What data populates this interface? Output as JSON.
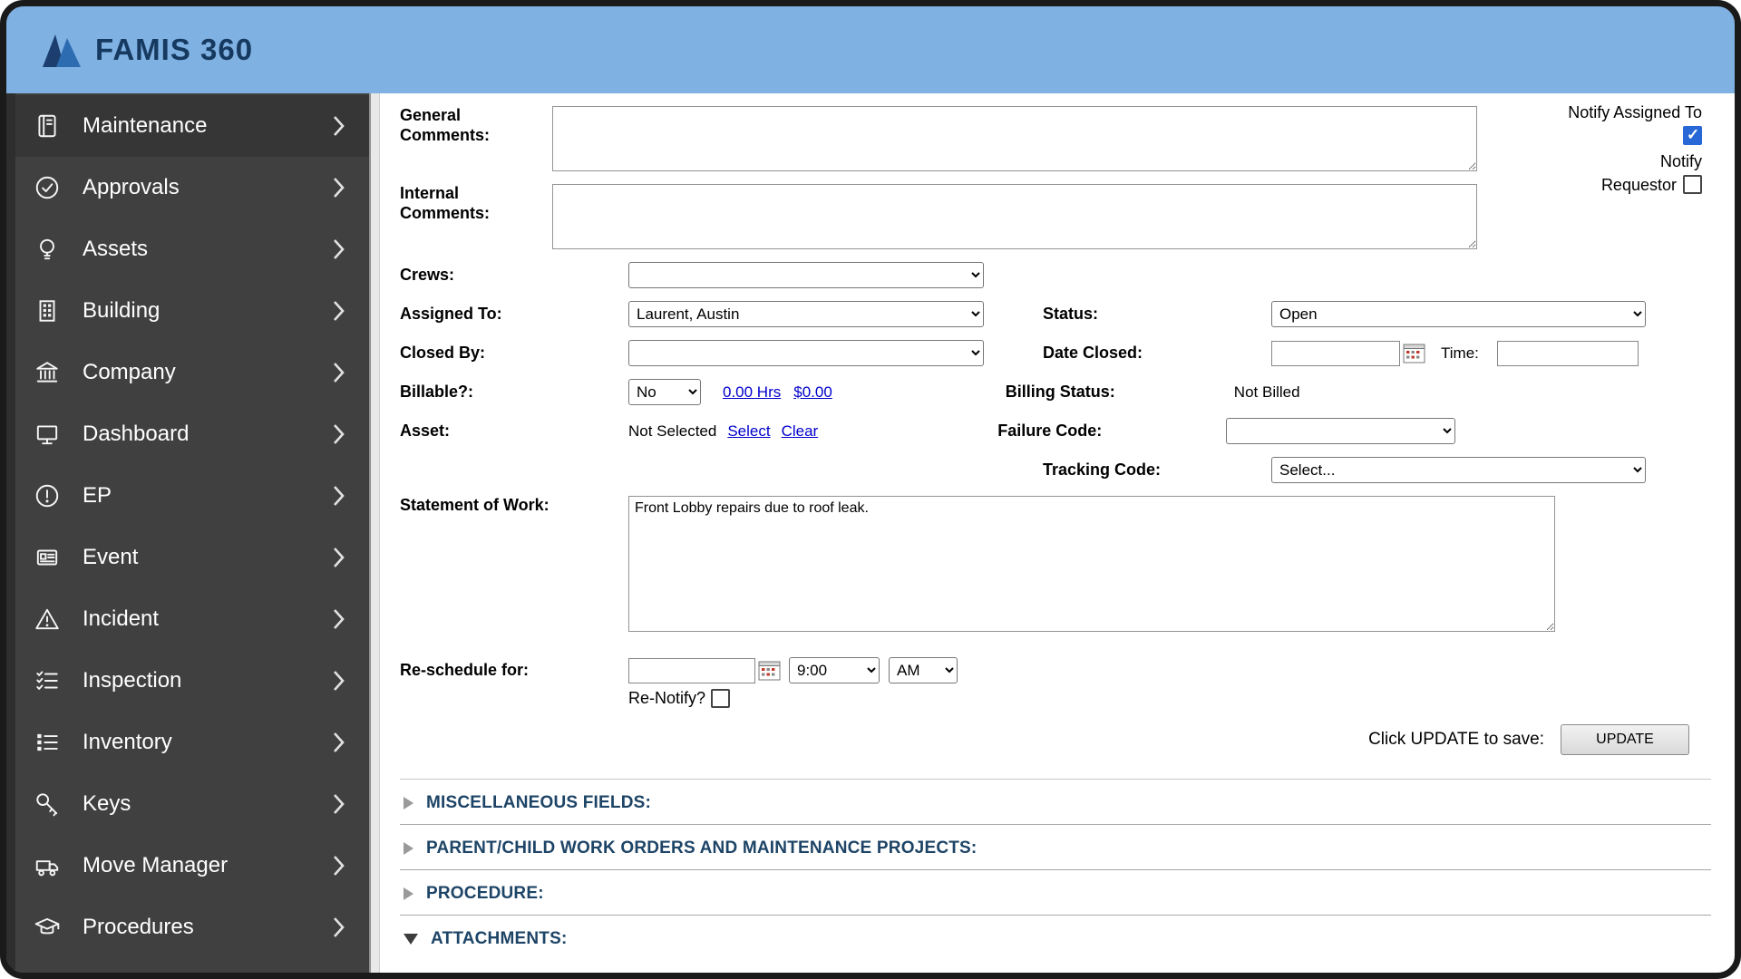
{
  "app": {
    "brand": "FAMIS 360"
  },
  "theme": {
    "header_blue": "#7fb1e3",
    "sidebar_gray": "#404040",
    "section_title_navy": "#1d4466",
    "link_blue": "#0000cc",
    "checkbox_blue": "#2767d6"
  },
  "sidebar": {
    "items": [
      {
        "label": "Maintenance",
        "icon": "book-icon"
      },
      {
        "label": "Approvals",
        "icon": "check-circle-icon"
      },
      {
        "label": "Assets",
        "icon": "lightbulb-icon"
      },
      {
        "label": "Building",
        "icon": "building-icon"
      },
      {
        "label": "Company",
        "icon": "bank-icon"
      },
      {
        "label": "Dashboard",
        "icon": "monitor-icon"
      },
      {
        "label": "EP",
        "icon": "exclamation-circle-icon"
      },
      {
        "label": "Event",
        "icon": "card-icon"
      },
      {
        "label": "Incident",
        "icon": "warning-triangle-icon"
      },
      {
        "label": "Inspection",
        "icon": "checklist-icon"
      },
      {
        "label": "Inventory",
        "icon": "list-icon"
      },
      {
        "label": "Keys",
        "icon": "key-icon"
      },
      {
        "label": "Move Manager",
        "icon": "truck-icon"
      },
      {
        "label": "Procedures",
        "icon": "graduation-cap-icon"
      }
    ]
  },
  "form": {
    "general_comments": {
      "label": "General Comments:",
      "value": ""
    },
    "internal_comments": {
      "label": "Internal Comments:",
      "value": ""
    },
    "notify": {
      "assigned_label": "Notify Assigned To",
      "assigned_checked": true,
      "requestor_label": "Notify Requestor",
      "requestor_checked": false
    },
    "crews": {
      "label": "Crews:",
      "value": ""
    },
    "assigned_to": {
      "label": "Assigned To:",
      "value": "Laurent, Austin"
    },
    "status": {
      "label": "Status:",
      "value": "Open"
    },
    "closed_by": {
      "label": "Closed By:",
      "value": ""
    },
    "date_closed": {
      "label": "Date Closed:",
      "value": "",
      "time_label": "Time:",
      "time_value": ""
    },
    "billable": {
      "label": "Billable?:",
      "value": "No",
      "hours_link": "0.00 Hrs",
      "amount_link": "$0.00"
    },
    "billing_status": {
      "label": "Billing Status:",
      "value": "Not Billed"
    },
    "asset": {
      "label": "Asset:",
      "value": "Not Selected",
      "select_link": "Select",
      "clear_link": "Clear"
    },
    "failure_code": {
      "label": "Failure Code:",
      "value": ""
    },
    "tracking_code": {
      "label": "Tracking Code:",
      "value": "Select..."
    },
    "statement_of_work": {
      "label": "Statement of Work:",
      "value": "Front Lobby repairs due to roof leak."
    },
    "reschedule": {
      "label": "Re-schedule for:",
      "date_value": "",
      "hour_value": "9:00",
      "ampm_value": "AM",
      "renotify_label": "Re-Notify?",
      "renotify_checked": false
    },
    "update": {
      "hint": "Click UPDATE to save:",
      "button_label": "UPDATE"
    }
  },
  "sections": [
    {
      "label": "MISCELLANEOUS FIELDS:",
      "expanded": false
    },
    {
      "label": "PARENT/CHILD WORK ORDERS AND MAINTENANCE PROJECTS:",
      "expanded": false
    },
    {
      "label": "PROCEDURE:",
      "expanded": false
    },
    {
      "label": "ATTACHMENTS:",
      "expanded": true
    }
  ]
}
